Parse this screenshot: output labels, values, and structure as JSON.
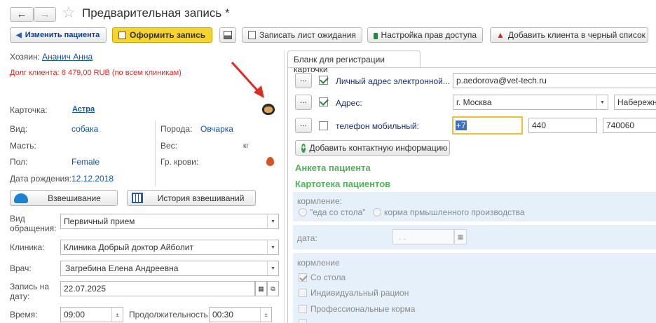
{
  "window": {
    "title": "Предварительная запись *"
  },
  "toolbar": {
    "change_patient": "Изменить пациента",
    "submit_record": "Оформить запись",
    "write_waitlist": "Записать лист ожидания",
    "access_settings": "Настройка прав доступа",
    "add_blacklist": "Добавить клиента в черный список"
  },
  "left": {
    "owner_label": "Хозяин:",
    "owner_name": "Ананич Анна",
    "debt": "Долг клиента: 6 479,00 RUB (по всем клиникам)",
    "card_label": "Карточка:",
    "card_value": "Астра",
    "species_label": "Вид:",
    "species_value": "собака",
    "breed_label": "Порода:",
    "breed_value": "Овчарка",
    "color_label": "Масть:",
    "weight_label": "Вес:",
    "weight_unit": "кг",
    "sex_label": "Пол:",
    "sex_value": "Female",
    "blood_label": "Гр. крови:",
    "dob_label": "Дата рождения:",
    "dob_value": "12.12.2018",
    "weighing_button": "Взвешивание",
    "weighing_history_button": "История взвешиваний",
    "visit_type_label": "Вид обращения:",
    "visit_type_value": "Первичный прием",
    "clinic_label": "Клиника:",
    "clinic_value": "Клиника Добрый доктор Айболит",
    "doctor_label": "Врач:",
    "doctor_value": "Загребина Елена Андреевна",
    "date_label": "Запись на дату:",
    "date_value": "22.07.2025",
    "time_label": "Время:",
    "time_value": "09:00",
    "duration_label": "Продолжительность:",
    "duration_value": "00:30"
  },
  "right": {
    "tab_label": "Бланк для регистрации карточки",
    "email_label": "Личный адрес электронной...",
    "email_value": "p.aedorova@vet-tech.ru",
    "address_label": "Адрес:",
    "address_city": "г. Москва",
    "address_street": "Набережна",
    "phone_label": "телефон мобильный:",
    "phone_code": "+7",
    "phone_area": "440",
    "phone_number": "740060",
    "dots": "...",
    "add_contact": "Добавить контактную информацию",
    "questionnaire_title": "Анкета пациента",
    "cardfile_title": "Картотека пациентов",
    "feeding_label": "кормление:",
    "feed_table": "\"еда со стола\"",
    "feed_industrial": "корма прмышленного производства",
    "date_field_label": "дата:",
    "date_placeholder": ". .",
    "feeding_label2": "кормление",
    "opt_table": "Со стола",
    "opt_individual": "Индивидуальный рацион",
    "opt_professional": "Профессиональные корма"
  },
  "colors": {
    "accent_yellow": "#f6d42c",
    "link_blue": "#0b55b0",
    "debt_red": "#e8231f",
    "section_green": "#4eb556",
    "arrow_red": "#e02a20"
  }
}
